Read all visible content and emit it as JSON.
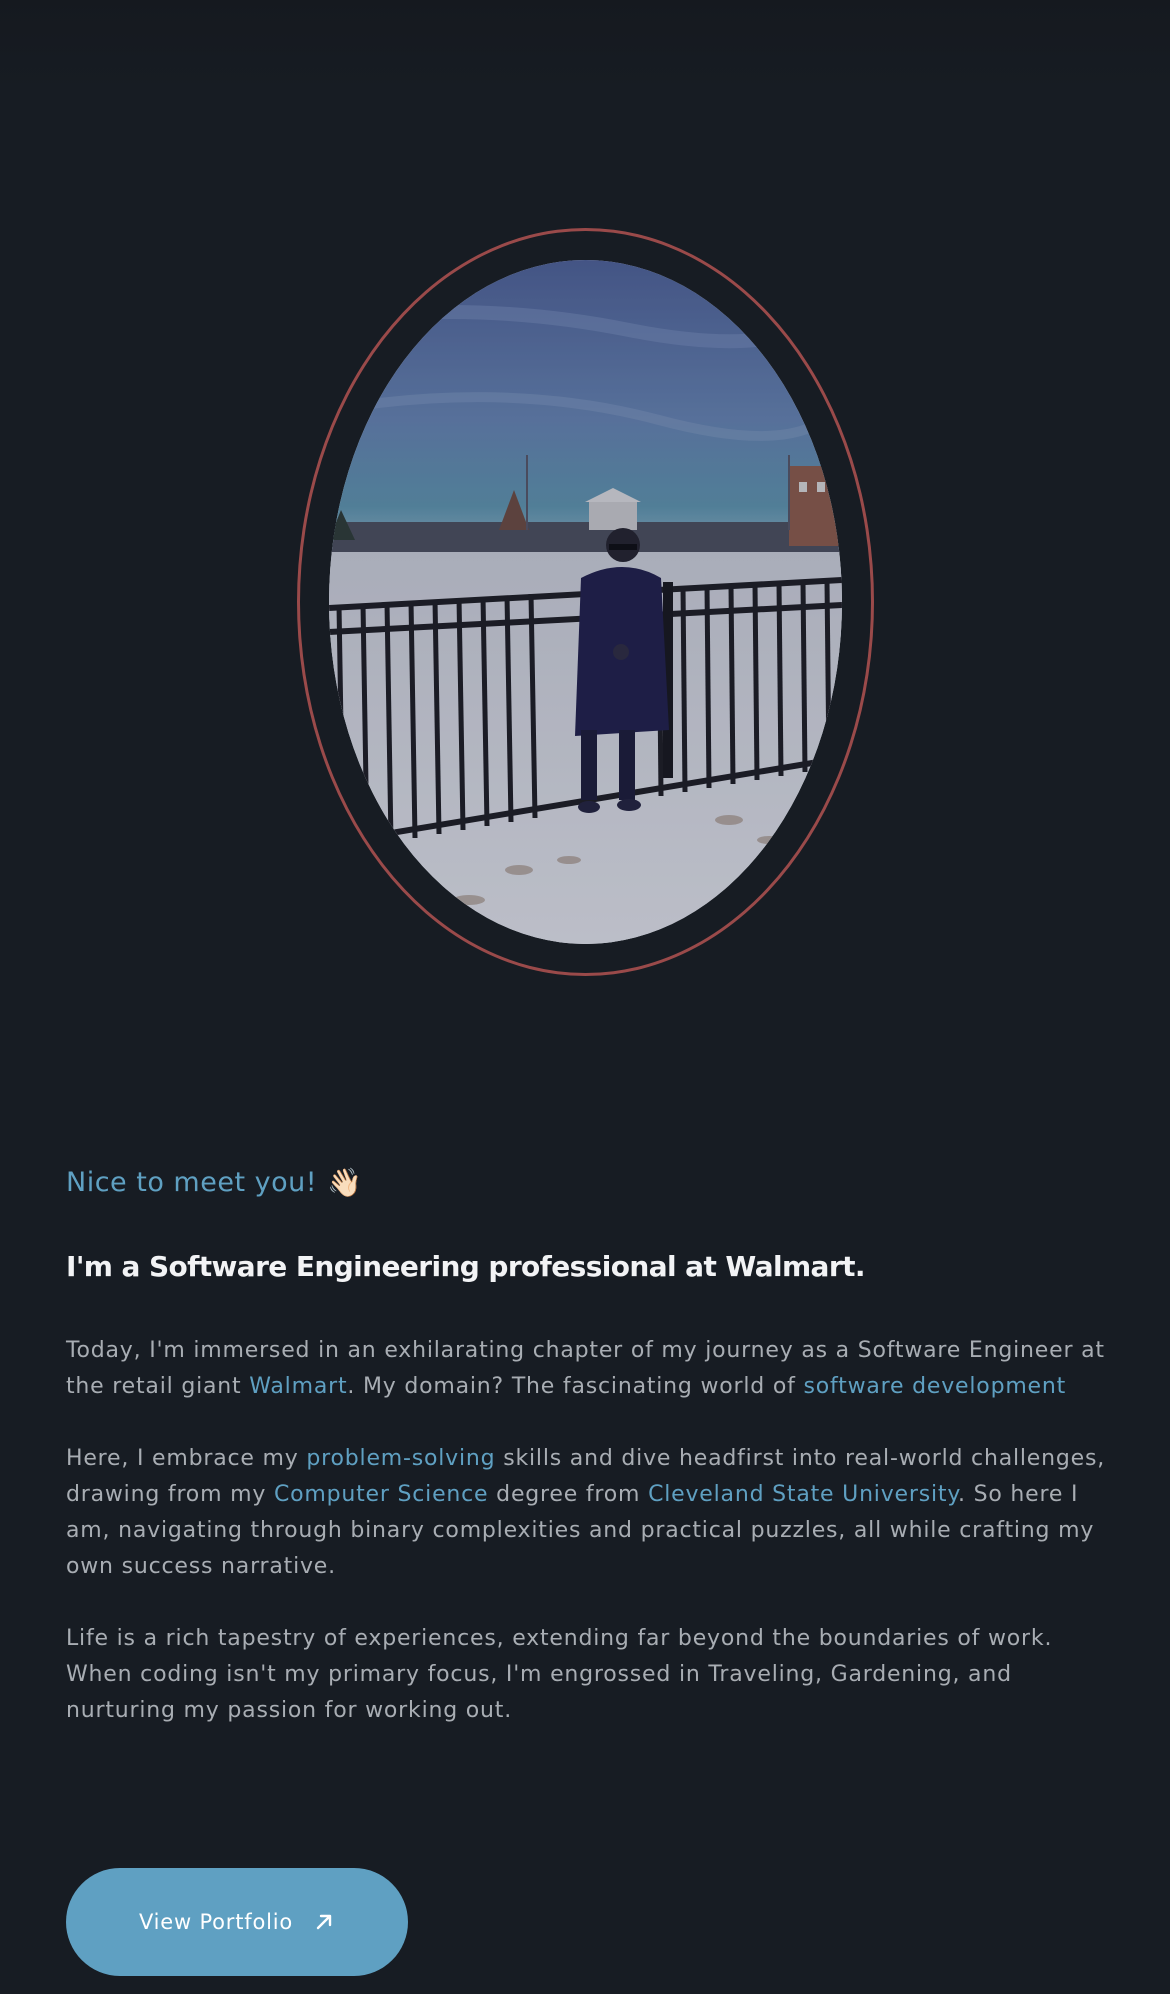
{
  "hero": {
    "photo": "man-in-dark-coat-by-fence-in-snow",
    "frame_color": "#9a4a4a"
  },
  "about": {
    "greeting": "Nice to meet you!",
    "greeting_icon": "👋🏻",
    "headline": "I'm a Software Engineering professional at Walmart.",
    "p1": {
      "t1": "Today, I'm immersed in an exhilarating chapter of my journey as a Software Engineer at the retail giant ",
      "link1": "Walmart",
      "t2": ". My domain? The fascinating world of ",
      "link2": "software development"
    },
    "p2": {
      "t1": "Here, I embrace my ",
      "link1": "problem-solving",
      "t2": " skills and dive headfirst into real-world challenges, drawing from my ",
      "link2": "Computer Science",
      "t3": " degree from ",
      "link3": "Cleveland State University",
      "t4": ". So here I am, navigating through binary complexities and practical puzzles, all while crafting my own success narrative."
    },
    "p3": "Life is a rich tapestry of experiences, extending far beyond the boundaries of work. When coding isn't my primary focus, I'm engrossed in Traveling, Gardening, and nurturing my passion for working out."
  },
  "cta": {
    "label": "View Portfolio",
    "icon": "arrow-up-right-icon"
  },
  "colors": {
    "background": "#171c23",
    "accent": "#5fa0c2",
    "text": "#a8adb3",
    "heading": "#f2f3f5"
  }
}
